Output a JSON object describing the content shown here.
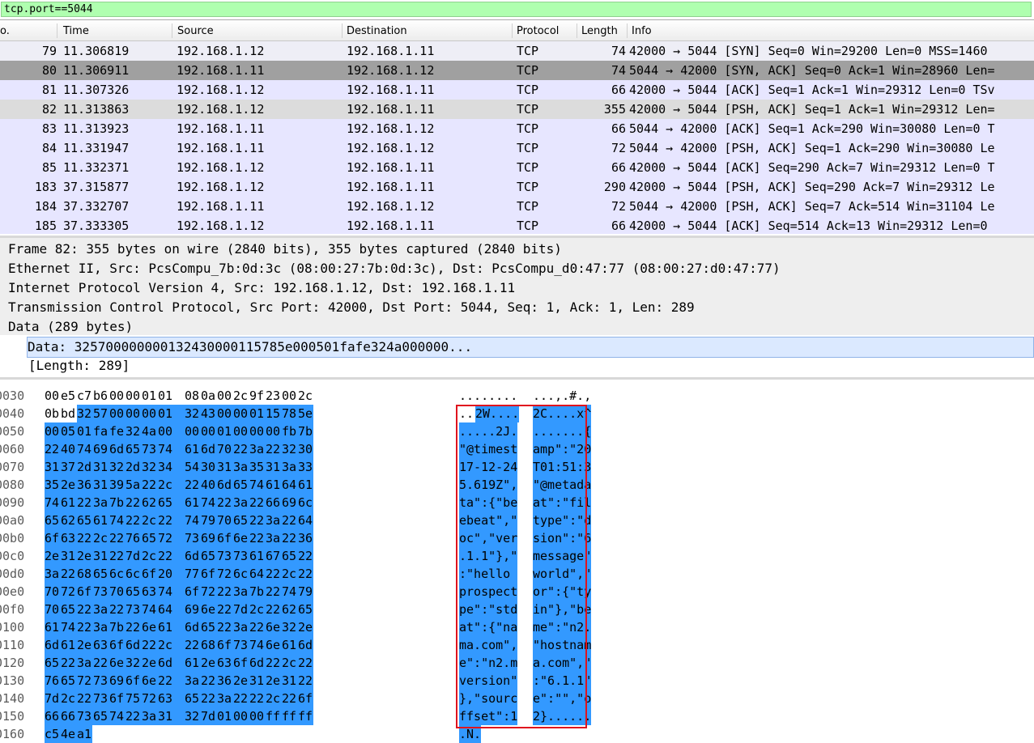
{
  "filter": {
    "value": "tcp.port==5044"
  },
  "columns": {
    "no": "o.",
    "time": "Time",
    "source": "Source",
    "destination": "Destination",
    "protocol": "Protocol",
    "length": "Length",
    "info": "Info"
  },
  "packets": [
    {
      "no": "79",
      "time": "11.306819",
      "src": "192.168.1.12",
      "dst": "192.168.1.11",
      "proto": "TCP",
      "len": "74",
      "info": "42000 → 5044 [SYN] Seq=0 Win=29200 Len=0 MSS=1460",
      "style": "marked"
    },
    {
      "no": "80",
      "time": "11.306911",
      "src": "192.168.1.11",
      "dst": "192.168.1.12",
      "proto": "TCP",
      "len": "74",
      "info": "5044 → 42000 [SYN, ACK] Seq=0 Ack=1 Win=28960 Len=",
      "style": "selected"
    },
    {
      "no": "81",
      "time": "11.307326",
      "src": "192.168.1.12",
      "dst": "192.168.1.11",
      "proto": "TCP",
      "len": "66",
      "info": "42000 → 5044 [ACK] Seq=1 Ack=1 Win=29312 Len=0 TSv",
      "style": "normal"
    },
    {
      "no": "82",
      "time": "11.313863",
      "src": "192.168.1.12",
      "dst": "192.168.1.11",
      "proto": "TCP",
      "len": "355",
      "info": "42000 → 5044 [PSH, ACK] Seq=1 Ack=1 Win=29312 Len=",
      "style": "gray"
    },
    {
      "no": "83",
      "time": "11.313923",
      "src": "192.168.1.11",
      "dst": "192.168.1.12",
      "proto": "TCP",
      "len": "66",
      "info": "5044 → 42000 [ACK] Seq=1 Ack=290 Win=30080 Len=0 T",
      "style": "normal"
    },
    {
      "no": "84",
      "time": "11.331947",
      "src": "192.168.1.11",
      "dst": "192.168.1.12",
      "proto": "TCP",
      "len": "72",
      "info": "5044 → 42000 [PSH, ACK] Seq=1 Ack=290 Win=30080 Le",
      "style": "normal"
    },
    {
      "no": "85",
      "time": "11.332371",
      "src": "192.168.1.12",
      "dst": "192.168.1.11",
      "proto": "TCP",
      "len": "66",
      "info": "42000 → 5044 [ACK] Seq=290 Ack=7 Win=29312 Len=0 T",
      "style": "normal"
    },
    {
      "no": "183",
      "time": "37.315877",
      "src": "192.168.1.12",
      "dst": "192.168.1.11",
      "proto": "TCP",
      "len": "290",
      "info": "42000 → 5044 [PSH, ACK] Seq=290 Ack=7 Win=29312 Le",
      "style": "normal"
    },
    {
      "no": "184",
      "time": "37.332707",
      "src": "192.168.1.11",
      "dst": "192.168.1.12",
      "proto": "TCP",
      "len": "72",
      "info": "5044 → 42000 [PSH, ACK] Seq=7 Ack=514 Win=31104 Le",
      "style": "normal"
    },
    {
      "no": "185",
      "time": "37.333305",
      "src": "192.168.1.12",
      "dst": "192.168.1.11",
      "proto": "TCP",
      "len": "66",
      "info": "42000 → 5044 [ACK] Seq=514 Ack=13 Win=29312 Len=0",
      "style": "normal"
    }
  ],
  "details": [
    "Frame 82: 355 bytes on wire (2840 bits), 355 bytes captured (2840 bits)",
    "Ethernet II, Src: PcsCompu_7b:0d:3c (08:00:27:7b:0d:3c), Dst: PcsCompu_d0:47:77 (08:00:27:d0:47:77)",
    "Internet Protocol Version 4, Src: 192.168.1.12, Dst: 192.168.1.11",
    "Transmission Control Protocol, Src Port: 42000, Dst Port: 5044, Seq: 1, Ack: 1, Len: 289",
    "Data (289 bytes)"
  ],
  "data_line": "Data: 325700000000132430000115785e000501fafe324a000000...",
  "length_line": "[Length: 289]",
  "hex_rows": [
    {
      "offset": "0030",
      "bytes": [
        "00",
        "e5",
        "c7",
        "b6",
        "00",
        "00",
        "01",
        "01",
        "08",
        "0a",
        "00",
        "2c",
        "9f",
        "23",
        "00",
        "2c"
      ],
      "ascii_a": "........",
      "ascii_b": "...,.#.,",
      "sel_start": 16
    },
    {
      "offset": "0040",
      "bytes": [
        "0b",
        "bd",
        "32",
        "57",
        "00",
        "00",
        "00",
        "01",
        "32",
        "43",
        "00",
        "00",
        "01",
        "15",
        "78",
        "5e"
      ],
      "ascii_a": "..2W....",
      "ascii_b": "2C....x^",
      "sel_start": 2
    },
    {
      "offset": "0050",
      "bytes": [
        "00",
        "05",
        "01",
        "fa",
        "fe",
        "32",
        "4a",
        "00",
        "00",
        "00",
        "01",
        "00",
        "00",
        "00",
        "fb",
        "7b"
      ],
      "ascii_a": ".....2J.",
      "ascii_b": ".......{",
      "sel_start": 0
    },
    {
      "offset": "0060",
      "bytes": [
        "22",
        "40",
        "74",
        "69",
        "6d",
        "65",
        "73",
        "74",
        "61",
        "6d",
        "70",
        "22",
        "3a",
        "22",
        "32",
        "30"
      ],
      "ascii_a": "\"@timest",
      "ascii_b": "amp\":\"20",
      "sel_start": 0
    },
    {
      "offset": "0070",
      "bytes": [
        "31",
        "37",
        "2d",
        "31",
        "32",
        "2d",
        "32",
        "34",
        "54",
        "30",
        "31",
        "3a",
        "35",
        "31",
        "3a",
        "33"
      ],
      "ascii_a": "17-12-24",
      "ascii_b": "T01:51:3",
      "sel_start": 0
    },
    {
      "offset": "0080",
      "bytes": [
        "35",
        "2e",
        "36",
        "31",
        "39",
        "5a",
        "22",
        "2c",
        "22",
        "40",
        "6d",
        "65",
        "74",
        "61",
        "64",
        "61"
      ],
      "ascii_a": "5.619Z\",",
      "ascii_b": "\"@metada",
      "sel_start": 0
    },
    {
      "offset": "0090",
      "bytes": [
        "74",
        "61",
        "22",
        "3a",
        "7b",
        "22",
        "62",
        "65",
        "61",
        "74",
        "22",
        "3a",
        "22",
        "66",
        "69",
        "6c"
      ],
      "ascii_a": "ta\":{\"be",
      "ascii_b": "at\":\"fil",
      "sel_start": 0
    },
    {
      "offset": "00a0",
      "bytes": [
        "65",
        "62",
        "65",
        "61",
        "74",
        "22",
        "2c",
        "22",
        "74",
        "79",
        "70",
        "65",
        "22",
        "3a",
        "22",
        "64"
      ],
      "ascii_a": "ebeat\",\"",
      "ascii_b": "type\":\"d",
      "sel_start": 0
    },
    {
      "offset": "00b0",
      "bytes": [
        "6f",
        "63",
        "22",
        "2c",
        "22",
        "76",
        "65",
        "72",
        "73",
        "69",
        "6f",
        "6e",
        "22",
        "3a",
        "22",
        "36"
      ],
      "ascii_a": "oc\",\"ver",
      "ascii_b": "sion\":\"6",
      "sel_start": 0
    },
    {
      "offset": "00c0",
      "bytes": [
        "2e",
        "31",
        "2e",
        "31",
        "22",
        "7d",
        "2c",
        "22",
        "6d",
        "65",
        "73",
        "73",
        "61",
        "67",
        "65",
        "22"
      ],
      "ascii_a": ".1.1\"},\"",
      "ascii_b": "message\"",
      "sel_start": 0
    },
    {
      "offset": "00d0",
      "bytes": [
        "3a",
        "22",
        "68",
        "65",
        "6c",
        "6c",
        "6f",
        "20",
        "77",
        "6f",
        "72",
        "6c",
        "64",
        "22",
        "2c",
        "22"
      ],
      "ascii_a": ":\"hello ",
      "ascii_b": "world\",\"",
      "sel_start": 0
    },
    {
      "offset": "00e0",
      "bytes": [
        "70",
        "72",
        "6f",
        "73",
        "70",
        "65",
        "63",
        "74",
        "6f",
        "72",
        "22",
        "3a",
        "7b",
        "22",
        "74",
        "79"
      ],
      "ascii_a": "prospect",
      "ascii_b": "or\":{\"ty",
      "sel_start": 0
    },
    {
      "offset": "00f0",
      "bytes": [
        "70",
        "65",
        "22",
        "3a",
        "22",
        "73",
        "74",
        "64",
        "69",
        "6e",
        "22",
        "7d",
        "2c",
        "22",
        "62",
        "65"
      ],
      "ascii_a": "pe\":\"std",
      "ascii_b": "in\"},\"be",
      "sel_start": 0
    },
    {
      "offset": "0100",
      "bytes": [
        "61",
        "74",
        "22",
        "3a",
        "7b",
        "22",
        "6e",
        "61",
        "6d",
        "65",
        "22",
        "3a",
        "22",
        "6e",
        "32",
        "2e"
      ],
      "ascii_a": "at\":{\"na",
      "ascii_b": "me\":\"n2.",
      "sel_start": 0
    },
    {
      "offset": "0110",
      "bytes": [
        "6d",
        "61",
        "2e",
        "63",
        "6f",
        "6d",
        "22",
        "2c",
        "22",
        "68",
        "6f",
        "73",
        "74",
        "6e",
        "61",
        "6d"
      ],
      "ascii_a": "ma.com\",",
      "ascii_b": "\"hostnam",
      "sel_start": 0
    },
    {
      "offset": "0120",
      "bytes": [
        "65",
        "22",
        "3a",
        "22",
        "6e",
        "32",
        "2e",
        "6d",
        "61",
        "2e",
        "63",
        "6f",
        "6d",
        "22",
        "2c",
        "22"
      ],
      "ascii_a": "e\":\"n2.m",
      "ascii_b": "a.com\",\"",
      "sel_start": 0
    },
    {
      "offset": "0130",
      "bytes": [
        "76",
        "65",
        "72",
        "73",
        "69",
        "6f",
        "6e",
        "22",
        "3a",
        "22",
        "36",
        "2e",
        "31",
        "2e",
        "31",
        "22"
      ],
      "ascii_a": "version\"",
      "ascii_b": ":\"6.1.1\"",
      "sel_start": 0
    },
    {
      "offset": "0140",
      "bytes": [
        "7d",
        "2c",
        "22",
        "73",
        "6f",
        "75",
        "72",
        "63",
        "65",
        "22",
        "3a",
        "22",
        "22",
        "2c",
        "22",
        "6f"
      ],
      "ascii_a": "},\"sourc",
      "ascii_b": "e\":\"\",\"o",
      "sel_start": 0
    },
    {
      "offset": "0150",
      "bytes": [
        "66",
        "66",
        "73",
        "65",
        "74",
        "22",
        "3a",
        "31",
        "32",
        "7d",
        "01",
        "00",
        "00",
        "ff",
        "ff",
        "ff"
      ],
      "ascii_a": "ffset\":1",
      "ascii_b": "2}......",
      "sel_start": 0
    },
    {
      "offset": "0160",
      "bytes": [
        "c5",
        "4e",
        "a1"
      ],
      "ascii_a": ".N.",
      "ascii_b": "",
      "sel_start": 0
    }
  ]
}
